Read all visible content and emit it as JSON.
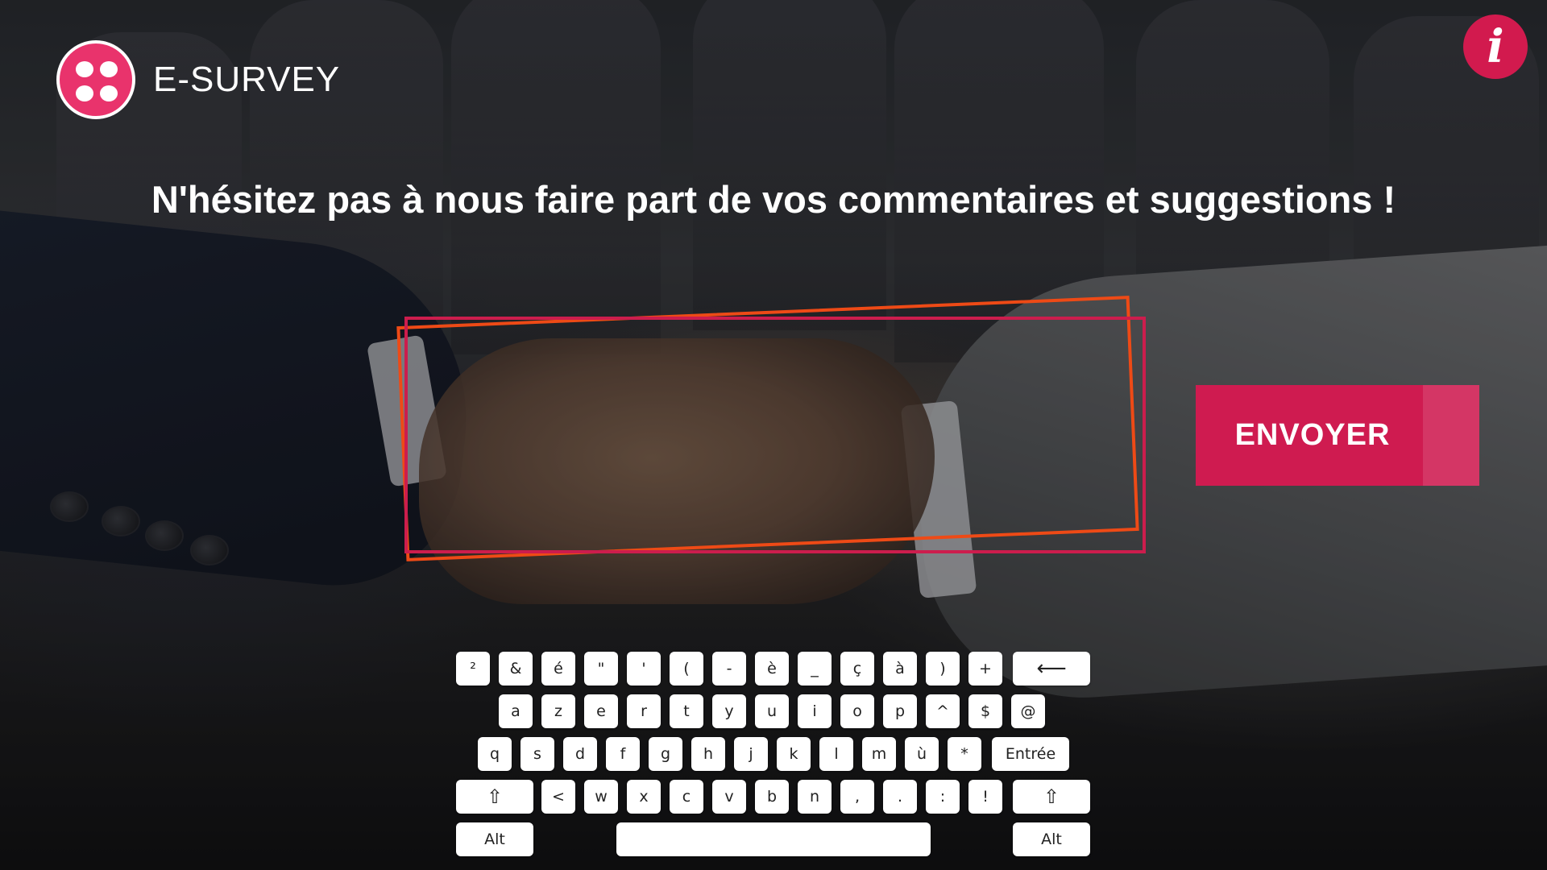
{
  "header": {
    "brand": "E-SURVEY",
    "info_icon": "i"
  },
  "headline": "N'hésitez pas à nous faire part de vos commentaires et suggestions !",
  "comment": {
    "value": "",
    "placeholder": ""
  },
  "submit": {
    "label": "ENVOYER"
  },
  "keyboard": {
    "rows": [
      [
        "²",
        "&",
        "é",
        "\"",
        "'",
        "(",
        "-",
        "è",
        "_",
        "ç",
        "à",
        ")",
        "+",
        "⟵"
      ],
      [
        "a",
        "z",
        "e",
        "r",
        "t",
        "y",
        "u",
        "i",
        "o",
        "p",
        "^",
        "$",
        "@"
      ],
      [
        "q",
        "s",
        "d",
        "f",
        "g",
        "h",
        "j",
        "k",
        "l",
        "m",
        "ù",
        "*",
        "Entrée"
      ],
      [
        "⇧",
        "<",
        "w",
        "x",
        "c",
        "v",
        "b",
        "n",
        ",",
        ".",
        ":",
        "!",
        "⇧"
      ],
      [
        "Alt",
        "",
        "Alt"
      ]
    ]
  },
  "colors": {
    "accent": "#cf1b50",
    "logo": "#e9336c",
    "frame_orange": "#ee4a16"
  },
  "icons": {
    "logo": "smiley-faces-logo",
    "info": "info-icon",
    "backspace": "backspace-arrow-icon",
    "shift": "shift-arrow-icon"
  }
}
